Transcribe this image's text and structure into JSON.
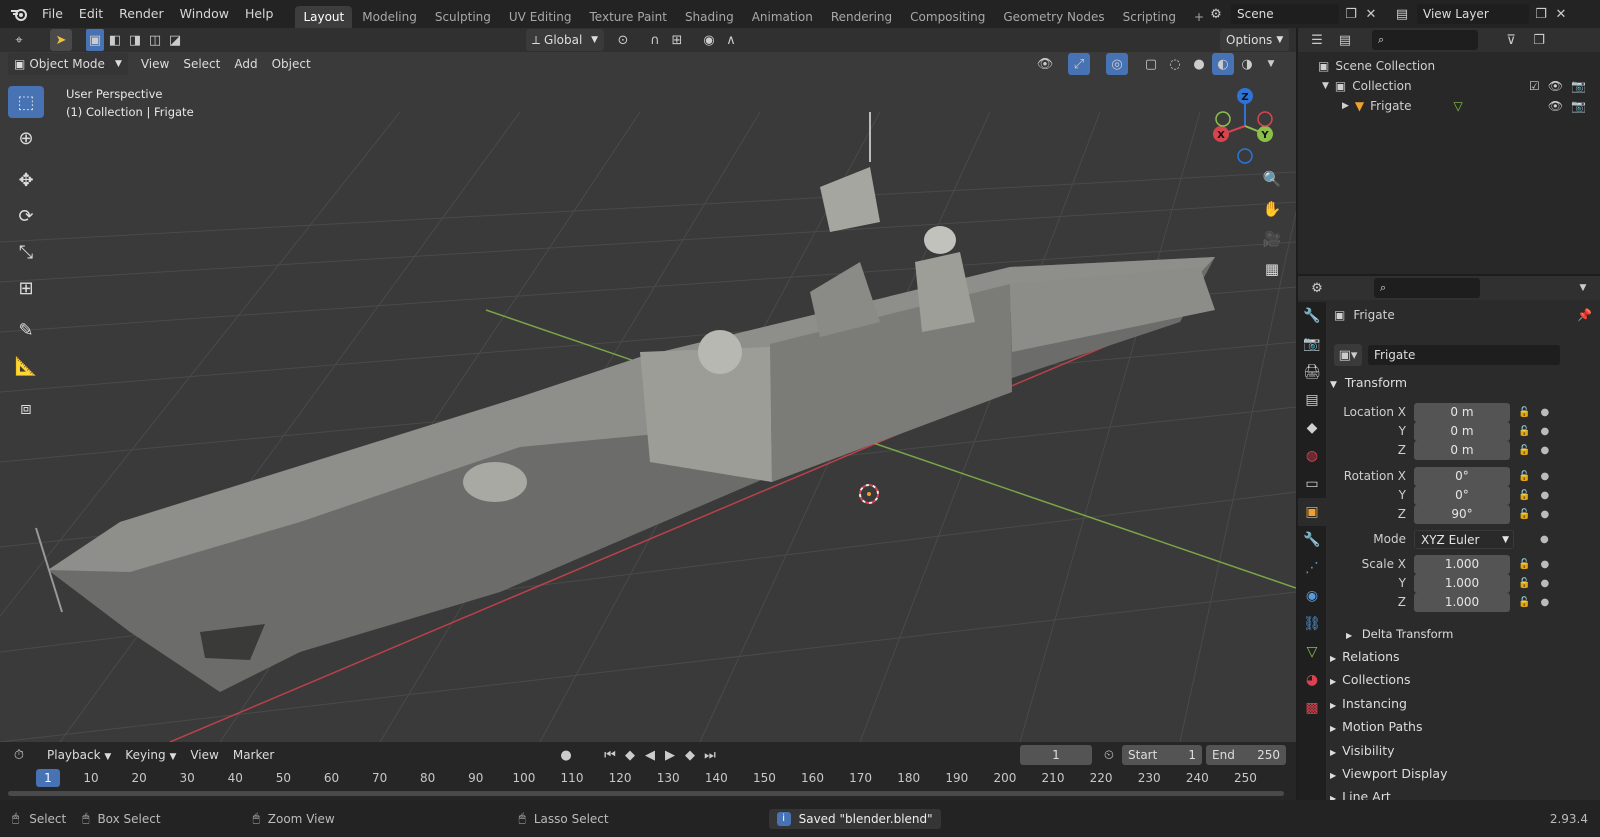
{
  "topbar": {
    "menus": [
      "File",
      "Edit",
      "Render",
      "Window",
      "Help"
    ],
    "workspaces": [
      "Layout",
      "Modeling",
      "Sculpting",
      "UV Editing",
      "Texture Paint",
      "Shading",
      "Animation",
      "Rendering",
      "Compositing",
      "Geometry Nodes",
      "Scripting"
    ],
    "active_workspace": "Layout",
    "add_tab": "+",
    "scene_name": "Scene",
    "view_layer": "View Layer"
  },
  "header": {
    "transform_orientation": "Global",
    "options_label": "Options"
  },
  "viewport": {
    "mode": "Object Mode",
    "menus": [
      "View",
      "Select",
      "Add",
      "Object"
    ],
    "perspective_label": "User Perspective",
    "collection_label": "(1) Collection | Frigate",
    "gizmo": {
      "x": "X",
      "y": "Y",
      "z": "Z"
    }
  },
  "outliner": {
    "scene_collection": "Scene Collection",
    "collection": "Collection",
    "object": "Frigate"
  },
  "properties": {
    "object_name": "Frigate",
    "data_name": "Frigate",
    "transform_title": "Transform",
    "location_label": "Location X",
    "y_label": "Y",
    "z_label": "Z",
    "location": [
      "0 m",
      "0 m",
      "0 m"
    ],
    "rotation_label": "Rotation X",
    "rotation": [
      "0°",
      "0°",
      "90°"
    ],
    "mode_label": "Mode",
    "mode_value": "XYZ Euler",
    "scale_label": "Scale X",
    "scale": [
      "1.000",
      "1.000",
      "1.000"
    ],
    "delta_transform": "Delta Transform",
    "sections": [
      "Relations",
      "Collections",
      "Instancing",
      "Motion Paths",
      "Visibility",
      "Viewport Display",
      "Line Art"
    ]
  },
  "timeline": {
    "menus": [
      "Playback",
      "Keying",
      "View",
      "Marker"
    ],
    "current_frame": "1",
    "start_label": "Start",
    "start": "1",
    "end_label": "End",
    "end": "250",
    "ticks": [
      "1",
      "10",
      "20",
      "30",
      "40",
      "50",
      "60",
      "70",
      "80",
      "90",
      "100",
      "110",
      "120",
      "130",
      "140",
      "150",
      "160",
      "170",
      "180",
      "190",
      "200",
      "210",
      "220",
      "230",
      "240",
      "250"
    ]
  },
  "statusbar": {
    "select": "Select",
    "box_select": "Box Select",
    "zoom_view": "Zoom View",
    "lasso_select": "Lasso Select",
    "message": "Saved \"blender.blend\"",
    "version": "2.93.4"
  },
  "colors": {
    "accent": "#4772b3",
    "x_axis": "#d9434f",
    "y_axis": "#8ac04a",
    "z_axis": "#2e74d8",
    "grid_bg": "#3a3a3a"
  }
}
